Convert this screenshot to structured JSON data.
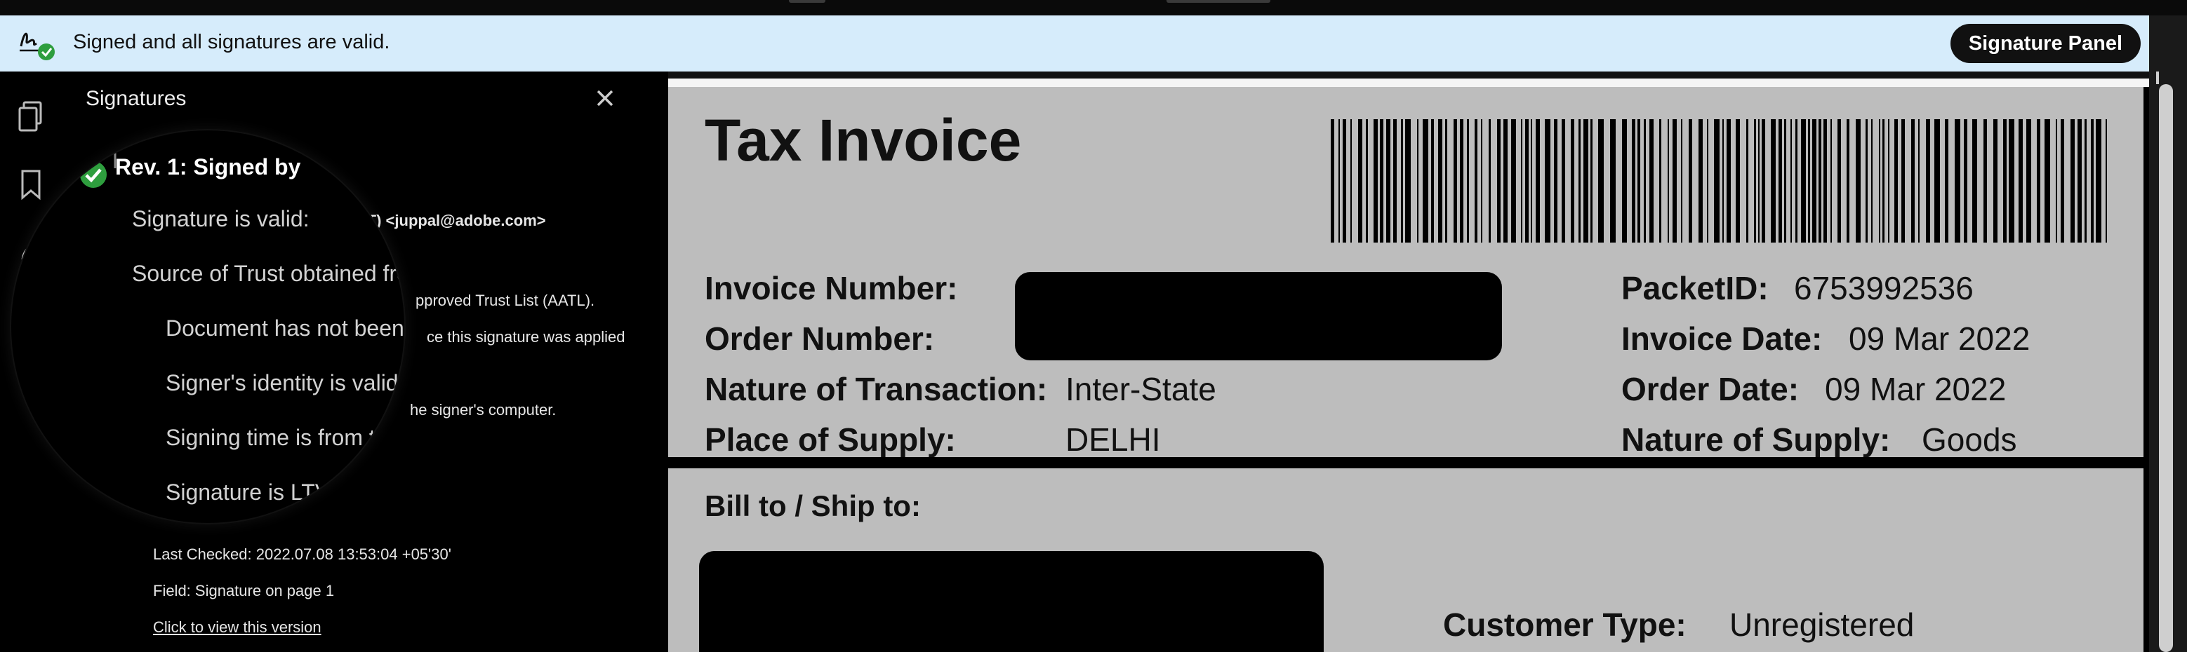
{
  "banner": {
    "message": "Signed and all signatures are valid.",
    "signature_panel_label": "Signature Panel",
    "icon": "signature-valid-icon"
  },
  "rail": {
    "icons": [
      "pages-icon",
      "bookmark-icon",
      "signature-icon"
    ]
  },
  "panel": {
    "title": "Signatures",
    "close_icon": "close-icon",
    "rev_label": "Rev. 1: Signed by",
    "signer_email_partial": "ST) <juppal@adobe.com>",
    "trust_partial": "pproved Trust List (AATL).",
    "modified_partial": "ce this signature was applied",
    "signer_computer_partial": "he signer's computer.",
    "last_checked": "Last Checked: 2022.07.08 13:53:04 +05'30'",
    "field": "Field: Signature on page 1",
    "view_version": "Click to view this version",
    "magnifier": {
      "rev_label": "Rev. 1: Signed by",
      "line1": "Signature is valid:",
      "line2": "Source of Trust obtained from",
      "line3": "Document has not been m",
      "line4": "Signer's identity is valid",
      "line5": "Signing time is from th",
      "line6": "Signature is LTV"
    }
  },
  "document": {
    "heading": "Tax Invoice",
    "left_fields": [
      {
        "label": "Invoice Number:",
        "value": ""
      },
      {
        "label": "Order Number:",
        "value": ""
      },
      {
        "label": "Nature of Transaction:",
        "value": "Inter-State"
      },
      {
        "label": "Place of Supply:",
        "value": "DELHI"
      }
    ],
    "right_fields": [
      {
        "label": "PacketID:",
        "value": "6753992536"
      },
      {
        "label": "Invoice Date:",
        "value": "09 Mar 2022"
      },
      {
        "label": "Order Date:",
        "value": "09 Mar 2022"
      },
      {
        "label": "Nature of Supply:",
        "value": "Goods"
      }
    ],
    "bill_to": "Bill to / Ship to:",
    "customer_type_label": "Customer Type:",
    "customer_type_value": "Unregistered"
  },
  "colors": {
    "banner_bg": "#d6ecfb",
    "valid_green": "#2e9e3e",
    "document_bg": "#bdbdbd"
  }
}
